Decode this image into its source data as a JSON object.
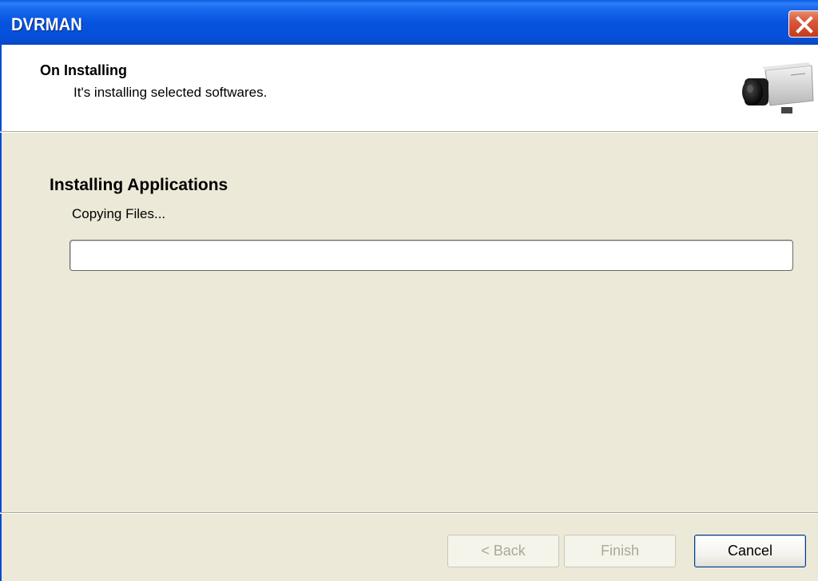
{
  "window": {
    "title": "DVRMAN",
    "close_icon": "close-icon"
  },
  "header": {
    "title": "On Installing",
    "subtitle": "It's installing selected softwares.",
    "icon": "camera-icon"
  },
  "main": {
    "section_title": "Installing Applications",
    "status": "Copying Files...",
    "progress": 0
  },
  "footer": {
    "back_label": "< Back",
    "finish_label": "Finish",
    "cancel_label": "Cancel"
  },
  "colors": {
    "titlebar": "#0653E0",
    "dialog_bg": "#ECE9D8",
    "close_button": "#D9573A",
    "progress_fill": "#2FB330"
  }
}
